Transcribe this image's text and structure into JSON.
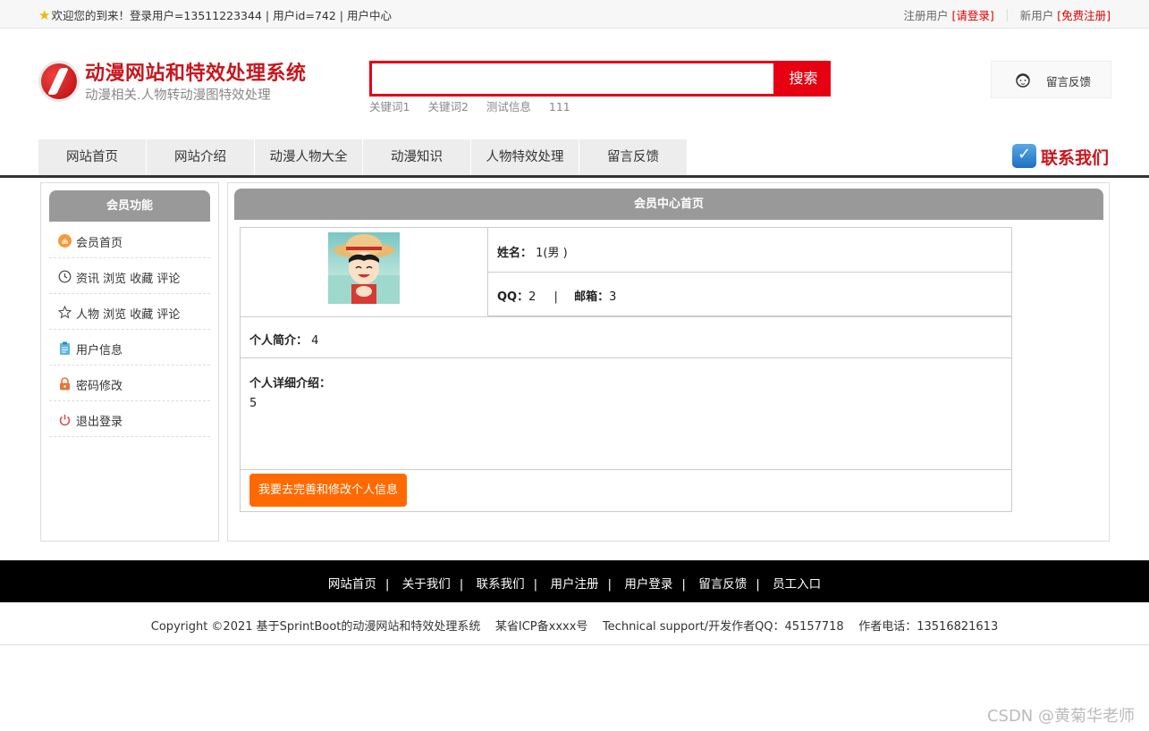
{
  "topbar": {
    "welcome": "欢迎您的到来！登录用户=13511223344 | 用户id=742 | 用户中心",
    "registered_label": "注册用户",
    "login_link": "[请登录]",
    "new_user_label": "新用户",
    "signup_link": "[免费注册]"
  },
  "header": {
    "title": "动漫网站和特效处理系统",
    "subtitle": "动漫相关.人物转动漫图特效处理",
    "search_placeholder": "",
    "search_button": "搜索",
    "hotwords": [
      "关键词1",
      "关键词2",
      "测试信息",
      "111"
    ],
    "feedback_label": "留言反馈"
  },
  "nav": {
    "items": [
      "网站首页",
      "网站介绍",
      "动漫人物大全",
      "动漫知识",
      "人物特效处理",
      "留言反馈"
    ],
    "contact_label": "联系我们"
  },
  "sidebar": {
    "title": "会员功能",
    "items": [
      {
        "label": "会员首页",
        "icon": "home-icon"
      },
      {
        "label": "资讯 浏览 收藏 评论",
        "icon": "clock-icon"
      },
      {
        "label": "人物 浏览 收藏 评论",
        "icon": "star-icon"
      },
      {
        "label": "用户信息",
        "icon": "clipboard-icon"
      },
      {
        "label": "密码修改",
        "icon": "lock-icon"
      },
      {
        "label": "退出登录",
        "icon": "power-icon"
      }
    ]
  },
  "main": {
    "title": "会员中心首页",
    "name_label": "姓名：",
    "name_value": "1(男 )",
    "qq_label": "QQ：",
    "qq_value": "2",
    "divider": "|",
    "email_label": "邮箱：",
    "email_value": "3",
    "intro_label": "个人简介：",
    "intro_value": "4",
    "detail_label": "个人详细介绍：",
    "detail_value": "5",
    "edit_button": "我要去完善和修改个人信息"
  },
  "footer": {
    "links": [
      "网站首页",
      "关于我们",
      "联系我们",
      "用户注册",
      "用户登录",
      "留言反馈",
      "员工入口"
    ],
    "copyright": "Copyright ©2021 基于SprintBoot的动漫网站和特效处理系统    某省ICP备xxxx号    Technical support/开发作者QQ：45157718    作者电话：13516821613"
  },
  "watermark": "CSDN @黄菊华老师",
  "colors": {
    "brand_red": "#c8161d",
    "search_red": "#e60012",
    "button_orange": "#ff6a00",
    "panel_gray": "#999999"
  }
}
